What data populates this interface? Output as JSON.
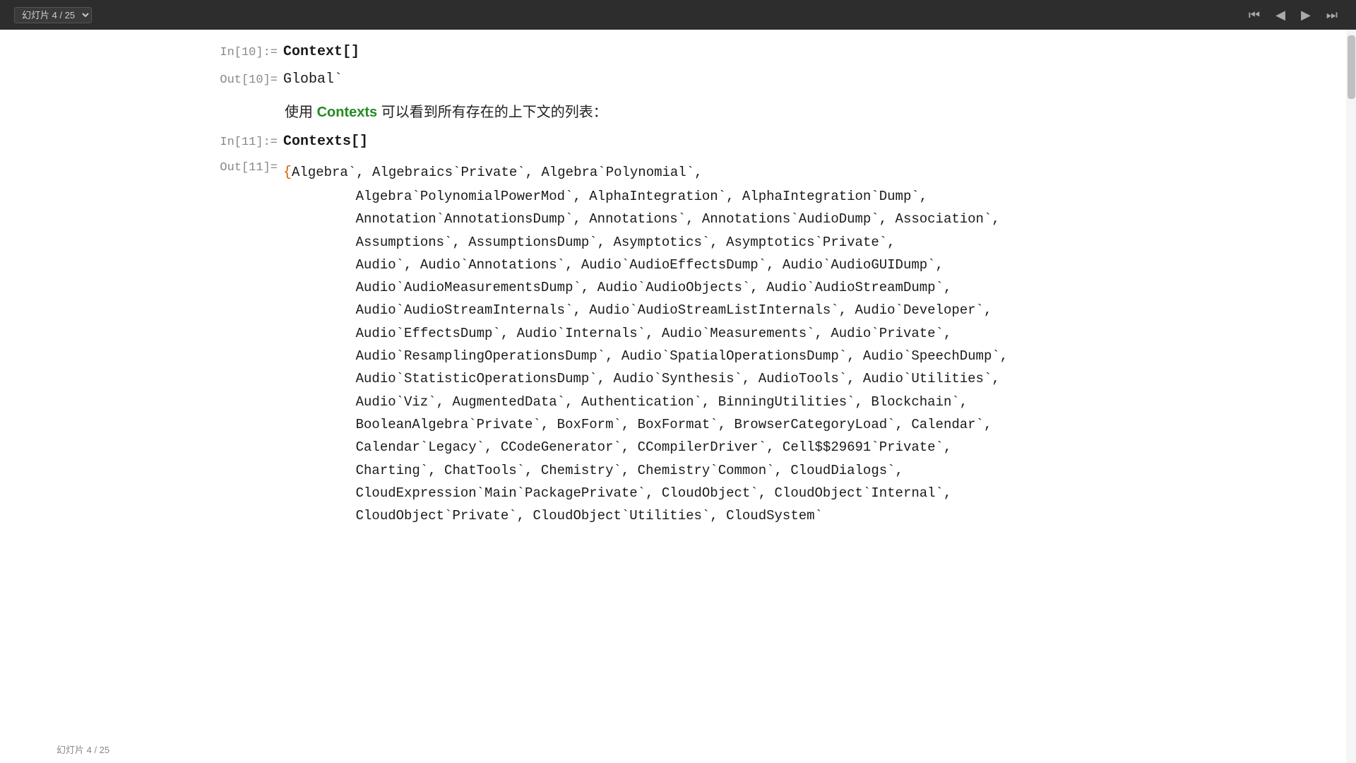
{
  "topbar": {
    "slide_selector_value": "幻灯片 4 / 25",
    "nav_buttons": [
      "⏮",
      "◀",
      "▶",
      "⏭"
    ]
  },
  "cells": [
    {
      "id": "in10",
      "label": "In[10]:=",
      "code": "Context[]",
      "type": "input"
    },
    {
      "id": "out10",
      "label": "Out[10]=",
      "value": "Global`",
      "type": "output-plain"
    },
    {
      "description_prefix": "使用 ",
      "description_keyword": "Contexts",
      "description_suffix": " 可以看到所有存在的上下文的列表："
    },
    {
      "id": "in11",
      "label": "In[11]:=",
      "code": "Contexts[]",
      "type": "input"
    },
    {
      "id": "out11",
      "label": "Out[11]=",
      "type": "output-list",
      "content": "{Algebra`, Algebraics`Private`, Algebra`Polynomial`, Algebra`PolynomialPowerMod`, AlphaIntegration`, AlphaIntegration`Dump`, Annotation`AnnotationsDump`, Annotations`, Annotations`AudioDump`, Association`, Assumptions`, AssumptionsDump`, Asymptotics`, Asymptotics`Private`, Audio`, Audio`Annotations`, Audio`AudioEffectsDump`, Audio`AudioGUIDump`, Audio`AudioMeasurementsDump`, Audio`AudioObjects`, Audio`AudioStreamDump`, Audio`AudioStreamInternals`, Audio`AudioStreamListInternals`, Audio`Developer`, Audio`EffectsDump`, Audio`Internals`, Audio`Measurements`, Audio`Private`, Audio`ResamplingOperationsDump`, Audio`SpatialOperationsDump`, Audio`SpeechDump`, Audio`StatisticOperationsDump`, Audio`Synthesis`, AudioTools`, Audio`Utilities`, Audio`Viz`, AugmentedData`, Authentication`, BinningUtilities`, Blockchain`, BooleanAlgebra`Private`, BoxForm`, BoxFormat`, BrowserCategoryLoad`, Calendar`, Calendar`Legacy`, CCodeGenerator`, CCompilerDriver`, Cell$$29691`Private`, Charting`, ChatTools`, Chemistry`, Chemistry`Common`, CloudDialogs`, CloudExpression`Main`PackagePrivate`, CloudObject`, CloudObject`Internal`, CloudObject`Private`, CloudObject`Utilities`, CloudSystem`"
    }
  ],
  "page_label": "幻灯片 4 / 25"
}
